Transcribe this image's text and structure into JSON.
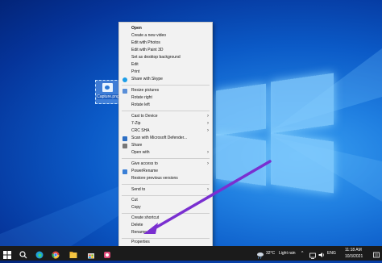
{
  "desktop": {
    "icon_label": "Capture.png"
  },
  "context_menu": {
    "items": [
      {
        "label": "Open"
      },
      {
        "label": "Create a new video"
      },
      {
        "label": "Edit with Photos"
      },
      {
        "label": "Edit with Paint 3D"
      },
      {
        "label": "Set as desktop background"
      },
      {
        "label": "Edit"
      },
      {
        "label": "Print"
      },
      {
        "label": "Share with Skype"
      },
      {
        "label": "Resize pictures"
      },
      {
        "label": "Rotate right"
      },
      {
        "label": "Rotate left"
      },
      {
        "label": "Cast to Device"
      },
      {
        "label": "7-Zip"
      },
      {
        "label": "CRC SHA"
      },
      {
        "label": "Scan with Microsoft Defender..."
      },
      {
        "label": "Share"
      },
      {
        "label": "Open with"
      },
      {
        "label": "Give access to"
      },
      {
        "label": "PowerRename"
      },
      {
        "label": "Restore previous versions"
      },
      {
        "label": "Send to"
      },
      {
        "label": "Cut"
      },
      {
        "label": "Copy"
      },
      {
        "label": "Create shortcut"
      },
      {
        "label": "Delete"
      },
      {
        "label": "Rename"
      },
      {
        "label": "Properties"
      }
    ]
  },
  "taskbar": {
    "weather_temp": "32°C",
    "weather_desc": "Light rain",
    "language": "ENG",
    "time": "11:18 AM",
    "date": "10/3/2021"
  },
  "colors": {
    "menu_bg": "#f2f2f2",
    "arrow": "#7a2fd0",
    "taskbar": "#1b1b1b"
  }
}
